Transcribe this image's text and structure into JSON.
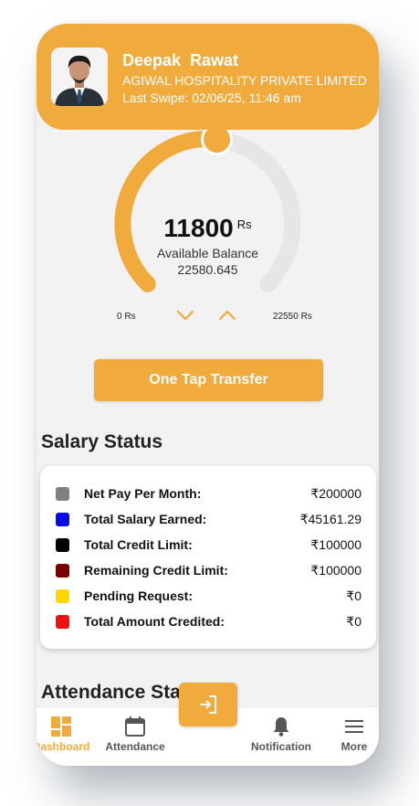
{
  "profile": {
    "name": "Deepak  Rawat",
    "company": "AGIWAL HOSPITALITY PRIVATE LIMITED",
    "last_swipe": "Last Swipe: 02/06/25, 11:46 am"
  },
  "balance": {
    "value": "11800",
    "unit": "Rs",
    "label": "Available Balance",
    "sub_value": "22580.645",
    "min_label": "0 Rs",
    "max_label": "22550 Rs",
    "fill_fraction": 0.523
  },
  "actions": {
    "one_tap_transfer": "One Tap Transfer"
  },
  "salary": {
    "title": "Salary Status",
    "rows": [
      {
        "label": "Net Pay Per Month:",
        "value": "₹200000",
        "color": "#808080"
      },
      {
        "label": "Total Salary Earned:",
        "value": "₹45161.29",
        "color": "#0a0ae6"
      },
      {
        "label": "Total Credit Limit:",
        "value": "₹100000",
        "color": "#000000"
      },
      {
        "label": "Remaining Credit Limit:",
        "value": "₹100000",
        "color": "#7a0000"
      },
      {
        "label": "Pending Request:",
        "value": "₹0",
        "color": "#ffd700"
      },
      {
        "label": "Total Amount Credited:",
        "value": "₹0",
        "color": "#ee1111"
      }
    ]
  },
  "attendance": {
    "title": "Attendance Sta"
  },
  "nav": {
    "dashboard": "Dashboard",
    "attendance": "Attendance",
    "notification": "Notification",
    "more": "More"
  },
  "colors": {
    "accent": "#f0ab3c",
    "track": "#e6e6e6",
    "background": "#f2f2f2"
  }
}
